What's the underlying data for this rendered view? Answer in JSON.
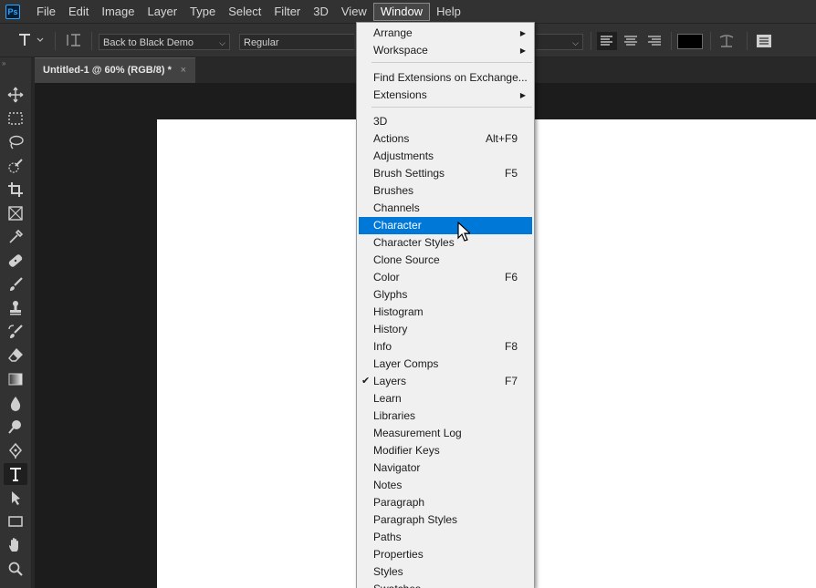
{
  "menubar": {
    "logo": "Ps",
    "items": [
      "File",
      "Edit",
      "Image",
      "Layer",
      "Type",
      "Select",
      "Filter",
      "3D",
      "View",
      "Window",
      "Help"
    ],
    "active": "Window"
  },
  "options": {
    "font_family": "Back to Black Demo",
    "font_style": "Regular",
    "color_swatch": "#000000"
  },
  "document_tab": {
    "title": "Untitled-1 @ 60% (RGB/8) *",
    "close": "×"
  },
  "tools": [
    "move-icon",
    "marquee-icon",
    "lasso-icon",
    "quick-select-icon",
    "crop-icon",
    "frame-icon",
    "eyedropper-icon",
    "healing-brush-icon",
    "brush-icon",
    "clone-stamp-icon",
    "history-brush-icon",
    "eraser-icon",
    "gradient-icon",
    "blur-icon",
    "dodge-icon",
    "pen-icon",
    "type-icon",
    "path-select-icon",
    "rectangle-icon",
    "hand-icon",
    "zoom-icon"
  ],
  "window_menu": {
    "group1": [
      {
        "label": "Arrange",
        "submenu": true
      },
      {
        "label": "Workspace",
        "submenu": true
      }
    ],
    "group2": [
      {
        "label": "Find Extensions on Exchange..."
      },
      {
        "label": "Extensions",
        "submenu": true
      }
    ],
    "group3": [
      {
        "label": "3D"
      },
      {
        "label": "Actions",
        "shortcut": "Alt+F9"
      },
      {
        "label": "Adjustments"
      },
      {
        "label": "Brush Settings",
        "shortcut": "F5"
      },
      {
        "label": "Brushes"
      },
      {
        "label": "Channels"
      },
      {
        "label": "Character",
        "highlighted": true
      },
      {
        "label": "Character Styles"
      },
      {
        "label": "Clone Source"
      },
      {
        "label": "Color",
        "shortcut": "F6"
      },
      {
        "label": "Glyphs"
      },
      {
        "label": "Histogram"
      },
      {
        "label": "History"
      },
      {
        "label": "Info",
        "shortcut": "F8"
      },
      {
        "label": "Layer Comps"
      },
      {
        "label": "Layers",
        "shortcut": "F7",
        "checked": true
      },
      {
        "label": "Learn"
      },
      {
        "label": "Libraries"
      },
      {
        "label": "Measurement Log"
      },
      {
        "label": "Modifier Keys"
      },
      {
        "label": "Navigator"
      },
      {
        "label": "Notes"
      },
      {
        "label": "Paragraph"
      },
      {
        "label": "Paragraph Styles"
      },
      {
        "label": "Paths"
      },
      {
        "label": "Properties"
      },
      {
        "label": "Styles"
      },
      {
        "label": "Swatches"
      }
    ],
    "highlight_color": "#0078d7"
  }
}
